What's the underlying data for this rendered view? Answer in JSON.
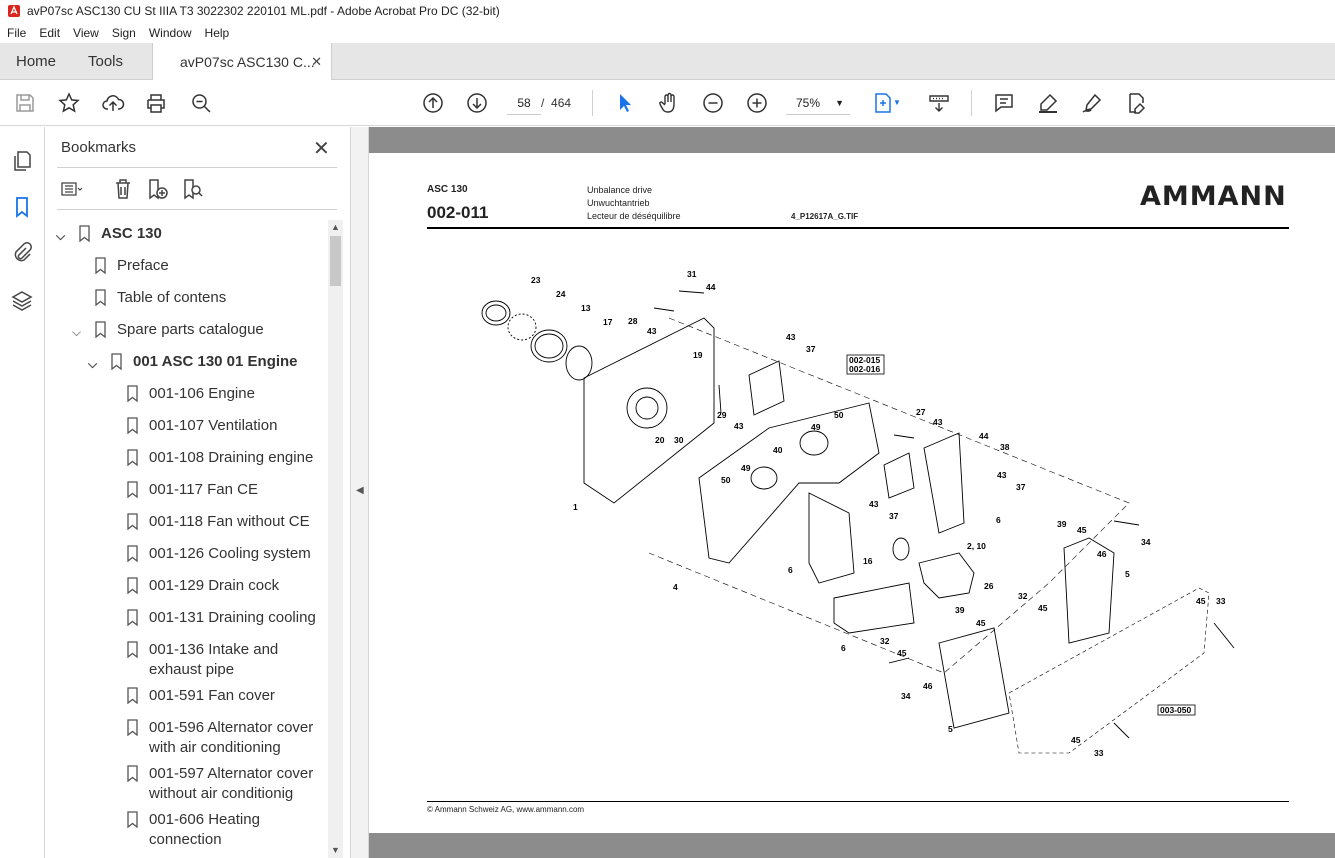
{
  "window": {
    "title": "avP07sc ASC130 CU St IIIA T3 3022302 220101 ML.pdf - Adobe Acrobat Pro DC (32-bit)"
  },
  "menu": [
    "File",
    "Edit",
    "View",
    "Sign",
    "Window",
    "Help"
  ],
  "tabs": {
    "home": "Home",
    "tools": "Tools",
    "document": "avP07sc ASC130 C...",
    "close": "✕"
  },
  "toolbar": {
    "page_current": "58",
    "page_separator": "/",
    "page_total": "464",
    "zoom": "75%"
  },
  "bookmarks": {
    "title": "Bookmarks",
    "close": "✕",
    "items": [
      {
        "label": "ASC 130",
        "level": 0,
        "expanded": true,
        "bold": true
      },
      {
        "label": "Preface",
        "level": 1
      },
      {
        "label": "Table of contens",
        "level": 1
      },
      {
        "label": "Spare parts catalogue",
        "level": 1,
        "expanded": true
      },
      {
        "label": "001 ASC 130 01 Engine",
        "level": 2,
        "expanded": true,
        "bold": true
      },
      {
        "label": "001-106 Engine",
        "level": 3
      },
      {
        "label": "001-107 Ventilation",
        "level": 3
      },
      {
        "label": "001-108 Draining engine",
        "level": 3
      },
      {
        "label": "001-117 Fan CE",
        "level": 3
      },
      {
        "label": "001-118 Fan without CE",
        "level": 3
      },
      {
        "label": "001-126 Cooling system",
        "level": 3
      },
      {
        "label": "001-129 Drain cock",
        "level": 3
      },
      {
        "label": "001-131 Draining cooling",
        "level": 3
      },
      {
        "label": "001-136 Intake and",
        "label2": "exhaust pipe",
        "level": 3
      },
      {
        "label": "001-591 Fan cover",
        "level": 3
      },
      {
        "label": "001-596 Alternator cover",
        "label2": "with air conditioning",
        "level": 3
      },
      {
        "label": "001-597 Alternator cover",
        "label2": "without air conditionig",
        "level": 3
      },
      {
        "label": "001-606 Heating",
        "label2": "connection",
        "level": 3
      }
    ]
  },
  "document_page": {
    "model": "ASC 130",
    "code": "002-011",
    "desc_en": "Unbalance drive",
    "desc_de": "Unwuchtantrieb",
    "desc_fr": "Lecteur de déséquilibre",
    "file": "4_P12617A_G.TIF",
    "logo": "AMMANN",
    "footer": "© Ammann Schweiz AG, www.ammann.com",
    "refs": [
      "002-015",
      "002-016",
      "003-050"
    ],
    "callouts": [
      "23",
      "24",
      "13",
      "17",
      "31",
      "44",
      "28",
      "43",
      "19",
      "20",
      "30",
      "29",
      "43",
      "37",
      "1",
      "27",
      "43",
      "50",
      "49",
      "40",
      "49",
      "50",
      "44",
      "38",
      "43",
      "37",
      "6",
      "43",
      "37",
      "39",
      "45",
      "34",
      "46",
      "4",
      "6",
      "16",
      "2, 10",
      "26",
      "39",
      "5",
      "32",
      "45",
      "45",
      "33",
      "6",
      "32",
      "45",
      "46",
      "34",
      "45",
      "5",
      "45",
      "33"
    ]
  }
}
